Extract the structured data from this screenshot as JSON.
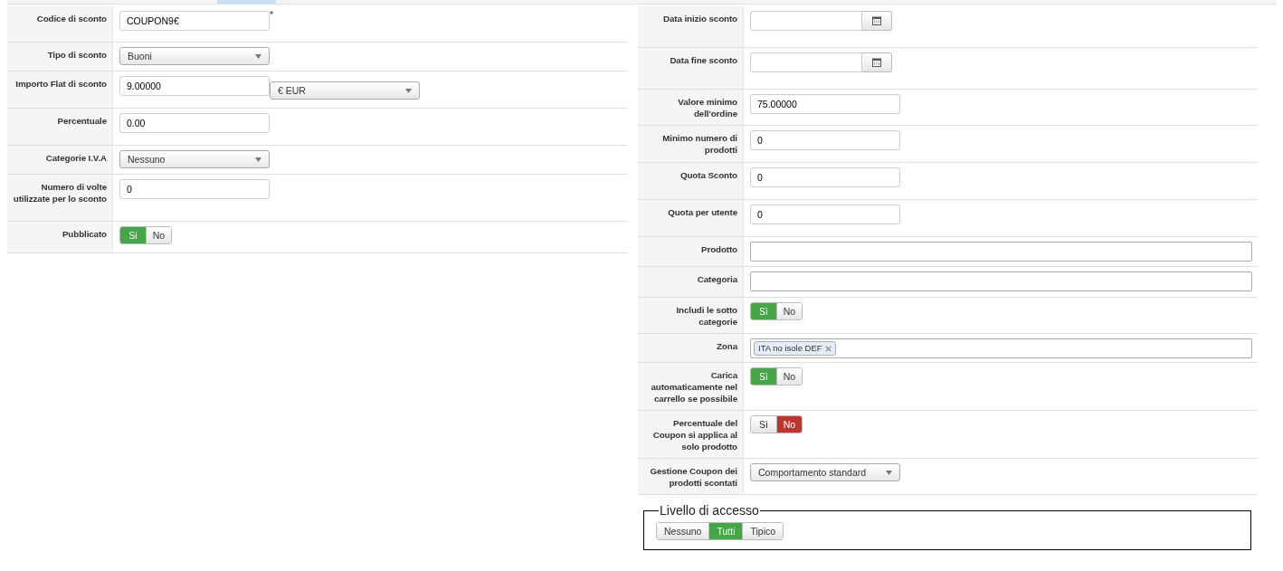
{
  "left_fields": [
    {
      "label": "Codice di sconto",
      "kind": "text",
      "value": "COUPON9€",
      "required_mark": "*"
    },
    {
      "label": "Tipo di sconto",
      "kind": "select",
      "value": "Buoni"
    },
    {
      "label": "Importo Flat di sconto",
      "kind": "amount",
      "value": "9.00000",
      "currency": "€ EUR"
    },
    {
      "label": "Percentuale",
      "kind": "text",
      "value": "0.00"
    },
    {
      "label": "Categorie I.V.A",
      "kind": "select",
      "value": "Nessuno"
    },
    {
      "label": "Numero di volte utilizzate per lo sconto",
      "kind": "text",
      "value": "0"
    },
    {
      "label": "Pubblicato",
      "kind": "toggle",
      "options": [
        {
          "label": "Si",
          "selected": true,
          "color": "#46a546"
        },
        {
          "label": "No",
          "selected": false
        }
      ]
    }
  ],
  "right_fields": [
    {
      "label": "Data inizio sconto",
      "kind": "date"
    },
    {
      "label": "Data fine sconto",
      "kind": "date"
    },
    {
      "label": "Valore minimo dell'ordine",
      "kind": "text",
      "value": "75.00000"
    },
    {
      "label": "Minimo numero di prodotti",
      "kind": "text",
      "value": "0"
    },
    {
      "label": "Quota Sconto",
      "kind": "text",
      "value": "0"
    },
    {
      "label": "Quota per utente",
      "kind": "text",
      "value": "0"
    },
    {
      "label": "Prodotto",
      "kind": "wide"
    },
    {
      "label": "Categoria",
      "kind": "wide"
    },
    {
      "label": "Includi le sotto categorie",
      "kind": "toggle",
      "options": [
        {
          "label": "Sì",
          "selected": true,
          "color": "#46a546"
        },
        {
          "label": "No",
          "selected": false
        }
      ]
    },
    {
      "label": "Zona",
      "kind": "tags",
      "tags": [
        "ITA no isole DEF"
      ]
    },
    {
      "label": "Carica automaticamente nel carrello se possibile",
      "kind": "toggle",
      "options": [
        {
          "label": "Sì",
          "selected": true,
          "color": "#46a546"
        },
        {
          "label": "No",
          "selected": false
        }
      ]
    },
    {
      "label": "Percentuale del Coupon si applica al solo prodotto",
      "kind": "toggle",
      "options": [
        {
          "label": "Sì",
          "selected": false
        },
        {
          "label": "No",
          "selected": true,
          "color": "#bd362f"
        }
      ]
    },
    {
      "label": "Gestione Coupon dei prodotti scontati",
      "kind": "select",
      "value": "Comportamento standard"
    }
  ],
  "access_level": {
    "legend": "Livello di accesso",
    "options": [
      {
        "label": "Nessuno",
        "selected": false
      },
      {
        "label": "Tutti",
        "selected": true,
        "color": "#46a546"
      },
      {
        "label": "Tipico",
        "selected": false
      }
    ]
  }
}
